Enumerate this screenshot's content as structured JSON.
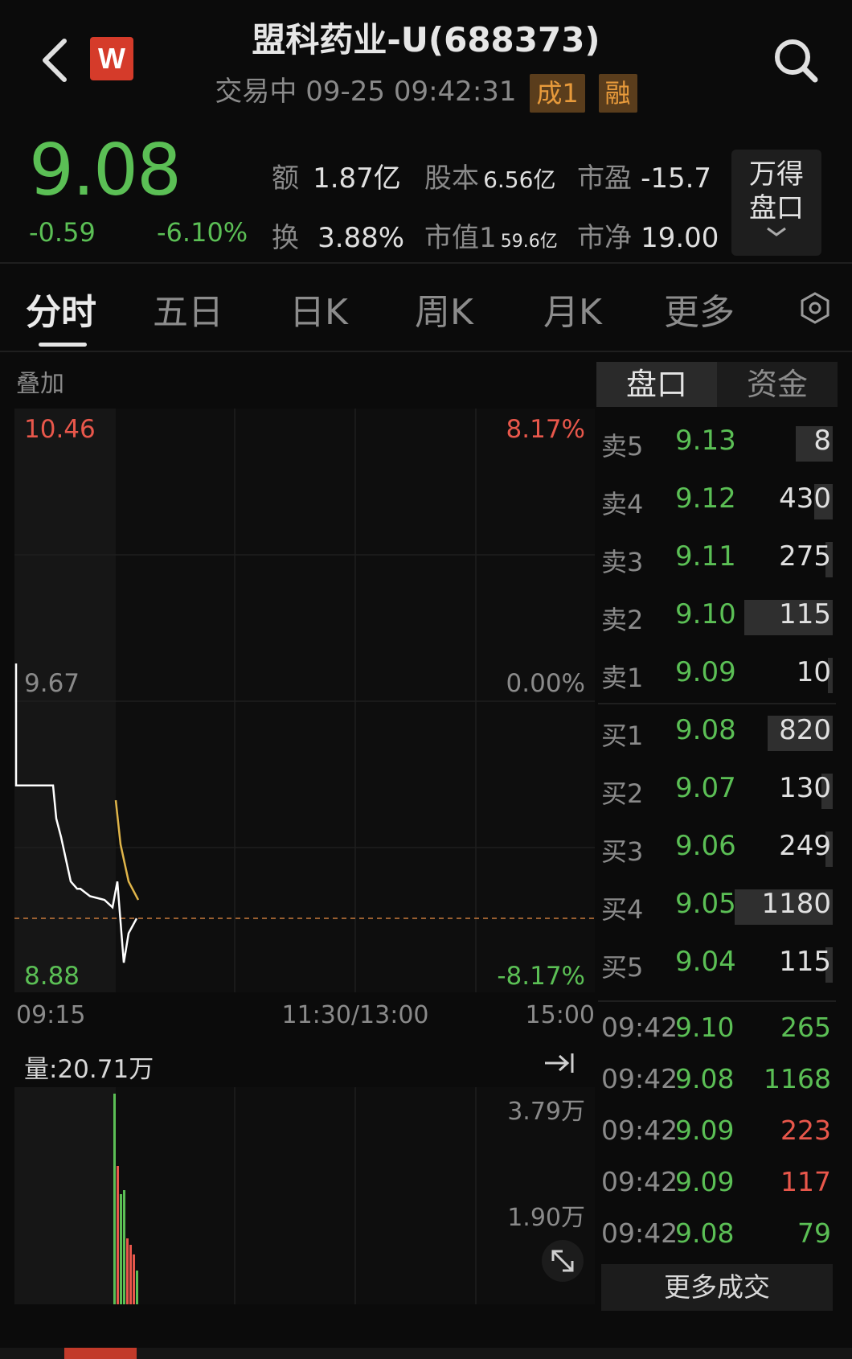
{
  "header": {
    "title": "盟科药业-U(688373)",
    "status": "交易中 09-25 09:42:31",
    "badges": [
      "成1",
      "融"
    ],
    "logo_text": "W"
  },
  "quote": {
    "price": "9.08",
    "change": "-0.59",
    "change_pct": "-6.10%",
    "stats": [
      {
        "label": "额",
        "value": "1.87亿"
      },
      {
        "label": "股本",
        "value": "6.56亿"
      },
      {
        "label": "市盈",
        "value": "-15.7"
      },
      {
        "label": "换",
        "value": "3.88%"
      },
      {
        "label": "市值1",
        "value": "59.6亿"
      },
      {
        "label": "市净",
        "value": "19.00"
      }
    ],
    "wind_button": [
      "万得",
      "盘口"
    ]
  },
  "tabs": [
    "分时",
    "五日",
    "日K",
    "周K",
    "月K",
    "更多"
  ],
  "chart": {
    "overlay_label": "叠加",
    "y_left": [
      "10.46",
      "9.67",
      "8.88"
    ],
    "y_right": [
      "8.17%",
      "0.00%",
      "-8.17%"
    ],
    "x_labels": [
      "09:15",
      "11:30/13:00",
      "15:00"
    ],
    "volume_label": "量:20.71万",
    "volume_ticks": [
      "3.79万",
      "1.90万"
    ],
    "colors": {
      "up": "#e8574b",
      "down": "#5bbf55",
      "price_line": "#ffffff",
      "avg_line": "#e0b54a"
    }
  },
  "chart_data": {
    "type": "line",
    "ylim": [
      8.88,
      10.46
    ],
    "prev_close": 9.67,
    "series": [
      {
        "values": [
          9.77,
          9.44,
          9.44,
          9.35,
          9.3,
          9.26,
          9.18,
          9.16,
          9.16,
          9.14,
          9.13,
          9.11,
          9.18,
          9.07,
          8.96,
          9.04,
          9.08
        ]
      },
      {
        "values": [
          9.4,
          9.28,
          9.18,
          9.13
        ]
      }
    ]
  },
  "orderbook": {
    "tabs": [
      "盘口",
      "资金"
    ],
    "asks": [
      {
        "label": "卖5",
        "price": "9.13",
        "vol": "8",
        "frac": 0.16
      },
      {
        "label": "卖4",
        "price": "9.12",
        "vol": "430",
        "frac": 0.08
      },
      {
        "label": "卖3",
        "price": "9.11",
        "vol": "275",
        "frac": 0.03
      },
      {
        "label": "卖2",
        "price": "9.10",
        "vol": "115",
        "frac": 0.38
      },
      {
        "label": "卖1",
        "price": "9.09",
        "vol": "10",
        "frac": 0.02
      }
    ],
    "bids": [
      {
        "label": "买1",
        "price": "9.08",
        "vol": "820",
        "frac": 0.28
      },
      {
        "label": "买2",
        "price": "9.07",
        "vol": "130",
        "frac": 0.05
      },
      {
        "label": "买3",
        "price": "9.06",
        "vol": "249",
        "frac": 0.03
      },
      {
        "label": "买4",
        "price": "9.05",
        "vol": "1180",
        "frac": 0.42
      },
      {
        "label": "买5",
        "price": "9.04",
        "vol": "115",
        "frac": 0.03
      }
    ],
    "trades": [
      {
        "time": "09:42",
        "price": "9.10",
        "vol": "265",
        "color": "green"
      },
      {
        "time": "09:42",
        "price": "9.08",
        "vol": "1168",
        "color": "green"
      },
      {
        "time": "09:42",
        "price": "9.09",
        "vol": "223",
        "color": "red"
      },
      {
        "time": "09:42",
        "price": "9.09",
        "vol": "117",
        "color": "red"
      },
      {
        "time": "09:42",
        "price": "9.08",
        "vol": "79",
        "color": "green"
      }
    ],
    "more_trades": "更多成交"
  }
}
